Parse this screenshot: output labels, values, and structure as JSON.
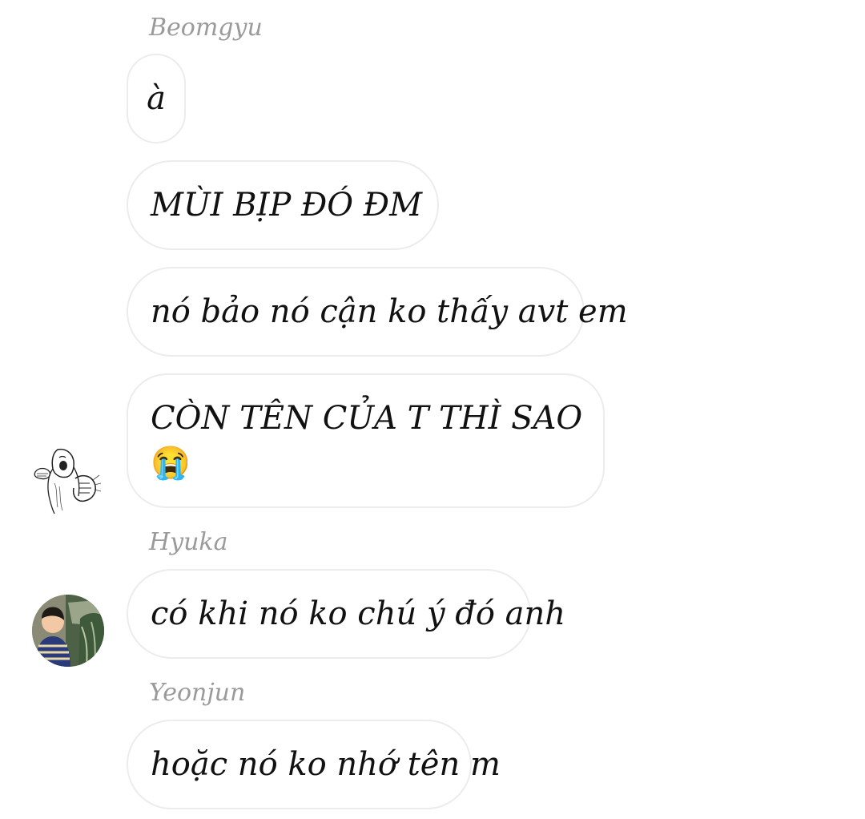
{
  "groups": [
    {
      "sender": "Beomgyu",
      "messages": [
        "à",
        "MÙI BỊP ĐÓ ĐM",
        "nó bảo nó cận ko thấy avt em",
        "CÒN TÊN CỦA T THÌ SAO"
      ],
      "last_message_emoji": "😭",
      "avatar_icon": "sketch-avatar-icon"
    },
    {
      "sender": "Hyuka",
      "messages": [
        "có khi nó ko chú ý đó anh"
      ],
      "avatar_icon": "photo-avatar-icon"
    },
    {
      "sender": "Yeonjun",
      "messages": [
        "hoặc nó ko nhớ tên m"
      ]
    }
  ],
  "colors": {
    "sender_name": "#9a9a9a",
    "bubble_border": "#ececec",
    "text": "#111111",
    "background": "#ffffff"
  }
}
